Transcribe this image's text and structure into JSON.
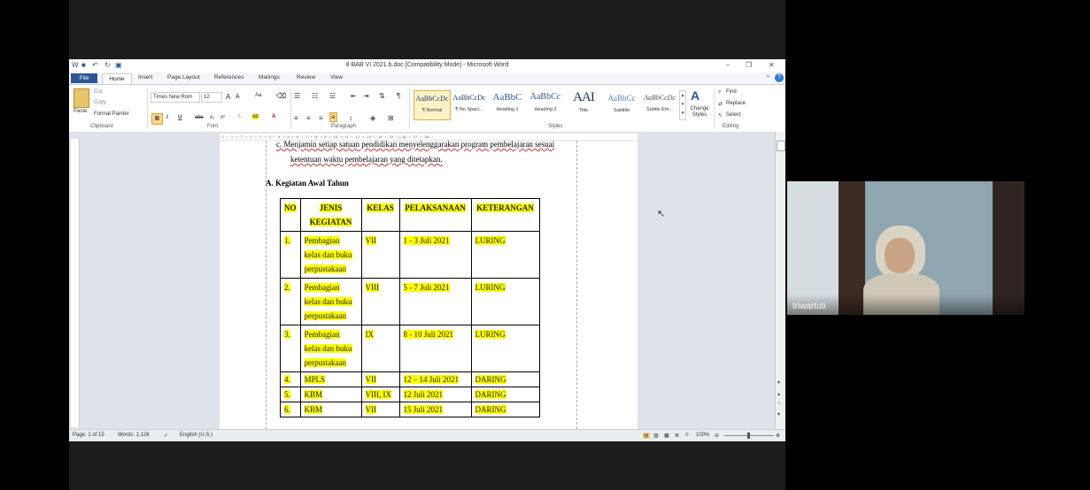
{
  "window": {
    "title": "8 BAB VI 2021 b.doc [Compatibility Mode] - Microsoft Word"
  },
  "tabs": [
    "File",
    "Home",
    "Insert",
    "Page Layout",
    "References",
    "Mailings",
    "Review",
    "View"
  ],
  "ribbon": {
    "clipboard": {
      "paste": "Paste",
      "cut": "Cut",
      "copy": "Copy",
      "format_painter": "Format Painter",
      "label": "Clipboard"
    },
    "font": {
      "name": "Times New Rom",
      "size": "12",
      "label": "Font"
    },
    "paragraph": {
      "label": "Paragraph"
    },
    "styles": {
      "label": "Styles",
      "items": [
        {
          "sample": "AaBbCcDc",
          "name": "¶ Normal"
        },
        {
          "sample": "AaBbCcDc",
          "name": "¶ No Spaci..."
        },
        {
          "sample": "AaBbC",
          "name": "Heading 1"
        },
        {
          "sample": "AaBbCc",
          "name": "Heading 2"
        },
        {
          "sample": "AAI",
          "name": "Title"
        },
        {
          "sample": "AaBbCc",
          "name": "Subtitle"
        },
        {
          "sample": "AaBbCcDc",
          "name": "Subtle Em..."
        }
      ],
      "change_styles": "Change Styles"
    },
    "editing": {
      "find": "Find",
      "replace": "Replace",
      "select": "Select",
      "label": "Editing"
    }
  },
  "ruler_text": "· 2 · ı · 1 · ı · ▽ · ı · 1 · ı · 2 · ı · 3 · ı · 4 · ı · 5 · ı · 6 · ı · 7 · ı · 8 · ı · 9 · ı · 10 · ı · 11 · ı · 12 · ı · 13 · ı · 14 · ı · 15 · ı △ 16 · ı · 17 · ı · 18 · ı",
  "document": {
    "line1": "c.   Menjamin setiap satuan pendidikan menyelenggarakan program pembelajaran sesuai",
    "line2": "ketentuan waktu pembelajaran yang ditetapkan.",
    "heading": "A.  Kegiatan Awal Tahun",
    "table": {
      "headers": [
        "NO",
        "JENIS KEGIATAN",
        "KELAS",
        "PELAKSANAAN",
        "KETERANGAN"
      ],
      "rows": [
        {
          "no": "1.",
          "kegiatan": "Pembagian kelas dan buku perpustakaan",
          "kelas": "VII",
          "pelaksanaan": "1 - 3 Juli 2021",
          "keterangan": "LURING"
        },
        {
          "no": "2.",
          "kegiatan": "Pembagian kelas dan buku perpustakaan",
          "kelas": "VIII",
          "pelaksanaan": "5 - 7  Juli 2021",
          "keterangan": "LURING"
        },
        {
          "no": "3.",
          "kegiatan": "Pembagian kelas dan buku perpustakaan",
          "kelas": "IX",
          "pelaksanaan": "8 - 10 Juli 2021",
          "keterangan": "LURING"
        },
        {
          "no": "4.",
          "kegiatan": "MPLS",
          "kelas": "VII",
          "pelaksanaan": "12 – 14 Juli 2021",
          "keterangan": "DARING"
        },
        {
          "no": "5.",
          "kegiatan": "KBM",
          "kelas": "VIII, IX",
          "pelaksanaan": "12 Juli 2021",
          "keterangan": "DARING"
        },
        {
          "no": "6.",
          "kegiatan": "KBM",
          "kelas": "VII",
          "pelaksanaan": "15 Juli 2021",
          "keterangan": "DARING"
        }
      ]
    }
  },
  "status": {
    "page": "Page: 1 of 15",
    "words": "Words: 1,128",
    "language": "English (U.S.)",
    "zoom": "100%"
  },
  "webcam": {
    "participant_name": "triwartuti"
  },
  "colors": {
    "highlight": "#ffff00",
    "file_tab": "#2b5797"
  }
}
